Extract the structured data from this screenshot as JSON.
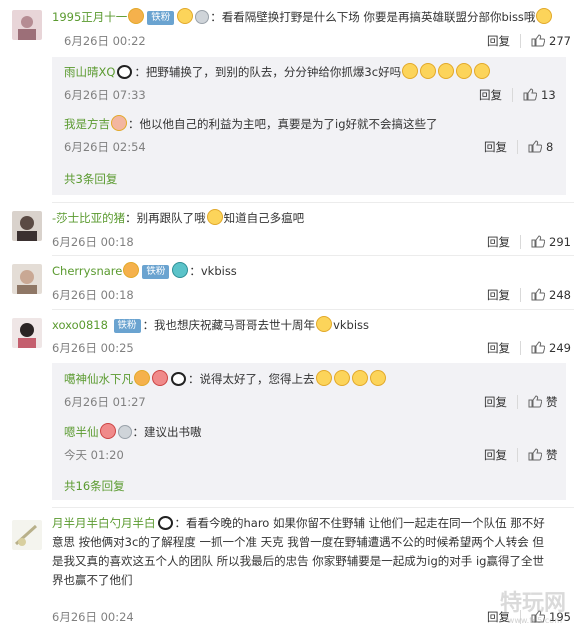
{
  "ui": {
    "reply": "回复",
    "like": "赞"
  },
  "comments": [
    {
      "user": "1995正月十一",
      "badge": "铁粉",
      "text": "：看看隔壁换打野是什么下场 你要是再搞英雄联盟分部你biss哦",
      "time": "6月26日 00:22",
      "likes": "277"
    },
    {
      "user": "-莎士比亚的猪",
      "text": "：别再跟队了哦",
      "text2": "知道自己多瘟吧",
      "time": "6月26日 00:18",
      "likes": "291"
    },
    {
      "user": "Cherrysnare",
      "badge": "铁粉",
      "text": "：vkbiss",
      "time": "6月26日 00:18",
      "likes": "248"
    },
    {
      "user": "xoxo0818",
      "badge": "铁粉",
      "text": "：我也想庆祝藏马哥哥去世十周年",
      "text2": "vkbiss",
      "time": "6月26日 00:25",
      "likes": "249"
    },
    {
      "user": "月半月半白勺月半白",
      "text_lines": [
        "：看看今晚的haro 如果你留不住野辅 让他们一起走在同一个队伍 那不好",
        "意思 按他俩对3c的了解程度 一抓一个准 天克 我曾一度在野辅遭遇不公的时候希望两个人转会 但",
        "是我又真的喜欢这五个人的团队 所以我最后的忠告 你家野辅要是一起成为ig的对手 ig赢得了全世",
        "界也赢不了他们"
      ],
      "time": "6月26日 00:24",
      "likes": "195"
    }
  ],
  "replies1": [
    {
      "user": "雨山晴XQ",
      "text": "：把野辅换了，到别的队去，分分钟给你抓爆3c好吗",
      "time": "6月26日 07:33",
      "likes": "13"
    },
    {
      "user": "我是方吉",
      "text": "：他以他自己的利益为主吧，真要是为了ig好就不会搞这些了",
      "time": "6月26日 02:54",
      "likes": "8"
    }
  ],
  "replies1_more": "共3条回复",
  "replies2": [
    {
      "user": "噶神仙水下凡",
      "text": "：说得太好了，您得上去",
      "time": "6月26日 01:27",
      "likes": "赞"
    },
    {
      "user": "嗯半仙",
      "text": "：建议出书嗷",
      "time": "今天 01:20",
      "likes": "赞"
    }
  ],
  "replies2_more": "共16条回复",
  "watermark": "特玩网",
  "watermark_sub": "www.te5.com"
}
